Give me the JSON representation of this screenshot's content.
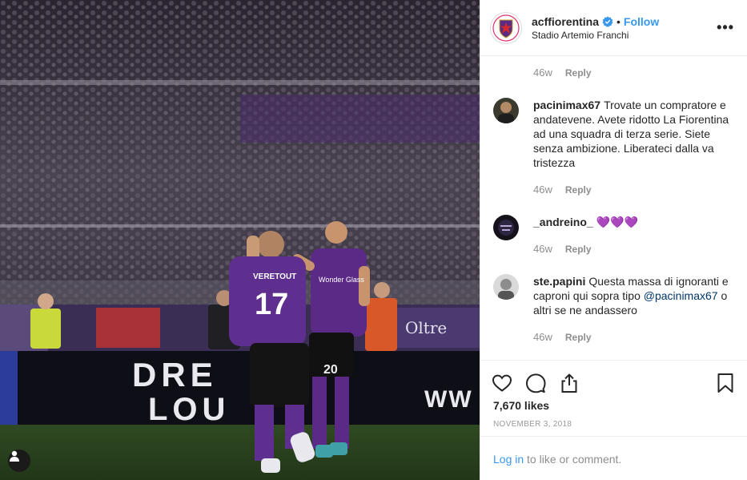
{
  "post": {
    "username": "acffiorentina",
    "follow_label": "Follow",
    "separator": "•",
    "location": "Stadio Artemio Franchi",
    "more_label": "•••"
  },
  "photo": {
    "banner_text_top": "DRE",
    "banner_text_bottom": "LOU",
    "banner_text_right": "WW",
    "player_left_name": "VERETOUT",
    "player_left_number": "17",
    "player_right_number": "20",
    "player_right_sponsor": "Wonder Glass",
    "ad_board_text": "Oltre"
  },
  "comments": [
    {
      "time": "46w",
      "reply_label": "Reply"
    },
    {
      "username": "pacinimax67",
      "text": "Trovate un compratore e andatevene. Avete ridotto La Fiorentina ad una squadra di terza serie. Siete senza ambizione. Liberateci dalla va tristezza",
      "time": "46w",
      "reply_label": "Reply"
    },
    {
      "username": "_andreino_",
      "text": "💜💜💜",
      "time": "46w",
      "reply_label": "Reply"
    },
    {
      "username": "ste.papini",
      "text_before": "Questa massa di ignoranti e caproni qui sopra tipo ",
      "mention": "@pacinimax67",
      "text_after": " o altri se ne andassero",
      "time": "46w",
      "reply_label": "Reply"
    }
  ],
  "actions": {
    "likes": "7,670 likes",
    "date": "NOVEMBER 3, 2018",
    "login_link": "Log in",
    "login_suffix": " to like or comment."
  },
  "colors": {
    "accent": "#3897f0",
    "fiorentina_purple": "#5b2a86",
    "heart_purple": "#9b4dca"
  },
  "icons": [
    "verified-badge-icon",
    "more-options-icon",
    "heart-icon",
    "comment-icon",
    "share-icon",
    "bookmark-icon",
    "user-tag-icon"
  ]
}
